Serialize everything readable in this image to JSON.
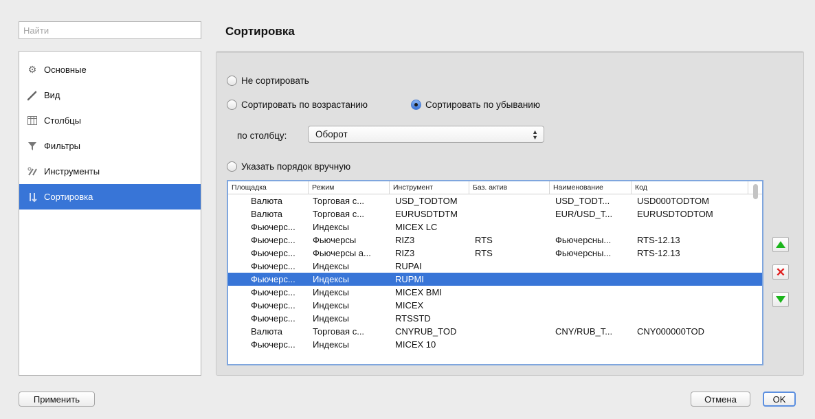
{
  "search": {
    "placeholder": "Найти"
  },
  "sidebar": {
    "items": [
      {
        "label": "Основные",
        "icon": "gear-icon"
      },
      {
        "label": "Вид",
        "icon": "brush-icon"
      },
      {
        "label": "Столбцы",
        "icon": "columns-icon"
      },
      {
        "label": "Фильтры",
        "icon": "filter-icon"
      },
      {
        "label": "Инструменты",
        "icon": "tools-icon"
      },
      {
        "label": "Сортировка",
        "icon": "sort-icon",
        "selected": true
      }
    ]
  },
  "main": {
    "title": "Сортировка",
    "radio_no_sort": "Не сортировать",
    "radio_ascending": "Сортировать по возрастанию",
    "radio_descending": "Сортировать по убыванию",
    "column_label": "по столбцу:",
    "column_select_value": "Оборот",
    "radio_manual": "Указать порядок вручную",
    "selected_radio": "descending",
    "table": {
      "headers": [
        "Площадка",
        "Режим",
        "Инструмент",
        "Баз. актив",
        "Наименование",
        "Код"
      ],
      "rows": [
        [
          "Валюта",
          "Торговая с...",
          "USD_TODTOM",
          "",
          "USD_TODT...",
          "USD000TODTOM"
        ],
        [
          "Валюта",
          "Торговая с...",
          "EURUSDTDTM",
          "",
          "EUR/USD_T...",
          "EURUSDTODTOM"
        ],
        [
          "Фьючерс...",
          "Индексы",
          "MICEX LC",
          "",
          "",
          ""
        ],
        [
          "Фьючерс...",
          "Фьючерсы",
          "RIZ3",
          "RTS",
          "Фьючерсны...",
          "RTS-12.13"
        ],
        [
          "Фьючерс...",
          "Фьючерсы а...",
          "RIZ3",
          "RTS",
          "Фьючерсны...",
          "RTS-12.13"
        ],
        [
          "Фьючерс...",
          "Индексы",
          "RUPAI",
          "",
          "",
          ""
        ],
        [
          "Фьючерс...",
          "Индексы",
          "RUPMI",
          "",
          "",
          ""
        ],
        [
          "Фьючерс...",
          "Индексы",
          "MICEX BMI",
          "",
          "",
          ""
        ],
        [
          "Фьючерс...",
          "Индексы",
          "MICEX",
          "",
          "",
          ""
        ],
        [
          "Фьючерс...",
          "Индексы",
          "RTSSTD",
          "",
          "",
          ""
        ],
        [
          "Валюта",
          "Торговая с...",
          "CNYRUB_TOD",
          "",
          "CNY/RUB_T...",
          "CNY000000TOD"
        ],
        [
          "Фьючерс...",
          "Индексы",
          "MICEX 10",
          "",
          "",
          ""
        ]
      ],
      "selected_row": 6
    },
    "side_buttons": [
      "move-up-icon",
      "delete-icon",
      "move-down-icon"
    ]
  },
  "footer": {
    "apply_label": "Применить",
    "cancel_label": "Отмена",
    "ok_label": "OK"
  },
  "colors": {
    "selection": "#3875d7",
    "arrow_green": "#1cb51c",
    "delete_red": "#e01e1e"
  }
}
